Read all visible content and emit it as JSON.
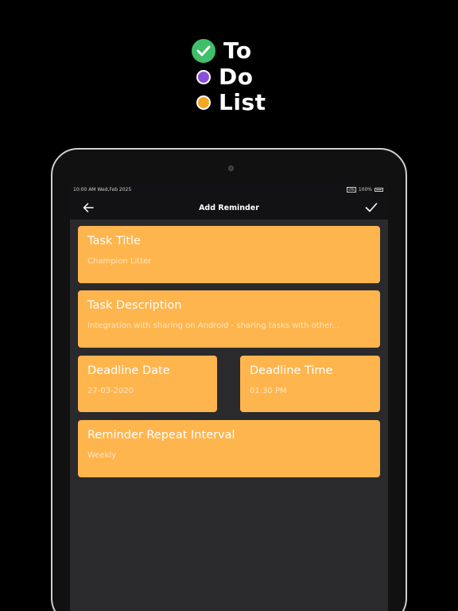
{
  "logo": {
    "word1": "To",
    "word2": "Do",
    "word3": "List",
    "icon1": "check-circle-icon",
    "colors": {
      "check": "#3fbf6a",
      "purple": "#8a4fd8",
      "orange": "#f5a623"
    }
  },
  "status_bar": {
    "time_date": "10:00 AM Wed,Feb 2025",
    "vpn": "VPN",
    "battery": "100%"
  },
  "app_bar": {
    "title": "Add Reminder",
    "back_icon": "arrow-left-icon",
    "confirm_icon": "checkmark-icon"
  },
  "form": {
    "task_title": {
      "label": "Task Title",
      "value": "Champion Litter"
    },
    "task_description": {
      "label": "Task Description",
      "value": "Integration with sharing on Android - sharing tasks with other..."
    },
    "deadline_date": {
      "label": "Deadline Date",
      "value": "27-03-2020"
    },
    "deadline_time": {
      "label": "Deadline Time",
      "value": "01:30 PM"
    },
    "repeat_interval": {
      "label": "Reminder Repeat Interval",
      "value": "Weekly"
    }
  },
  "colors": {
    "background": "#000000",
    "screen": "#2a2a2d",
    "app_bar": "#121214",
    "card": "#ffb54d",
    "card_text": "#ffffff"
  }
}
